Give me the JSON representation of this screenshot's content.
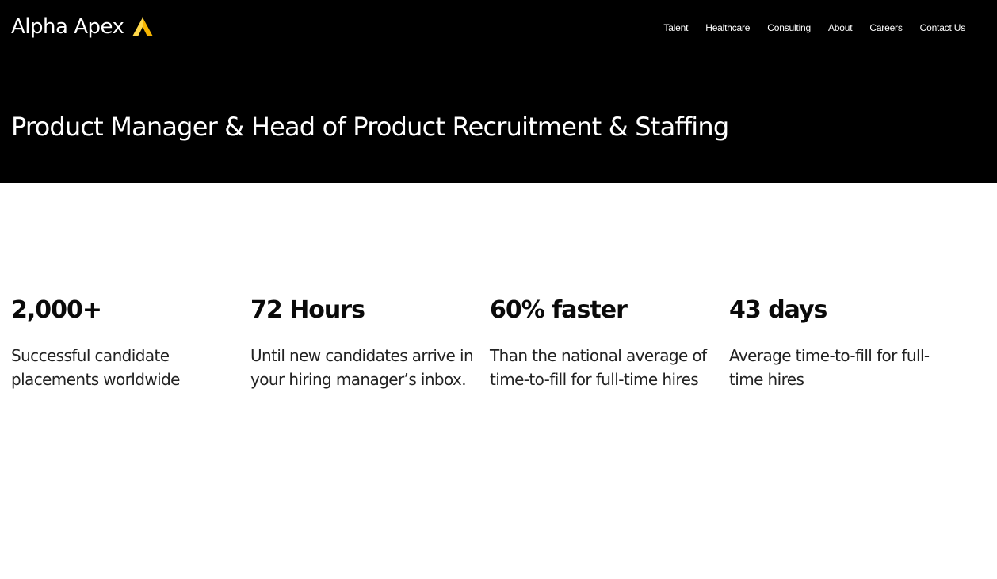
{
  "brand": {
    "name": "Alpha Apex",
    "logo_icon": "apex-triangle-icon",
    "accent_colors": [
      "#f5b400",
      "#ffd84a"
    ]
  },
  "nav": {
    "items": [
      {
        "label": "Talent"
      },
      {
        "label": "Healthcare"
      },
      {
        "label": "Consulting"
      },
      {
        "label": "About"
      },
      {
        "label": "Careers"
      },
      {
        "label": "Contact Us"
      }
    ]
  },
  "hero": {
    "title": "Product Manager & Head of Product Recruitment & Staffing"
  },
  "stats": [
    {
      "value": "2,000+",
      "description": "Successful candidate placements worldwide"
    },
    {
      "value": "72 Hours",
      "description": "Until new candidates arrive in your hiring manager’s inbox."
    },
    {
      "value": "60% faster",
      "description": "Than the national average of time-to-fill for full-time hires"
    },
    {
      "value": "43 days",
      "description": "Average time-to-fill for full-time hires"
    }
  ],
  "colors": {
    "header_bg": "#000000",
    "page_bg": "#ffffff",
    "text_dark": "#0a0a0a"
  }
}
